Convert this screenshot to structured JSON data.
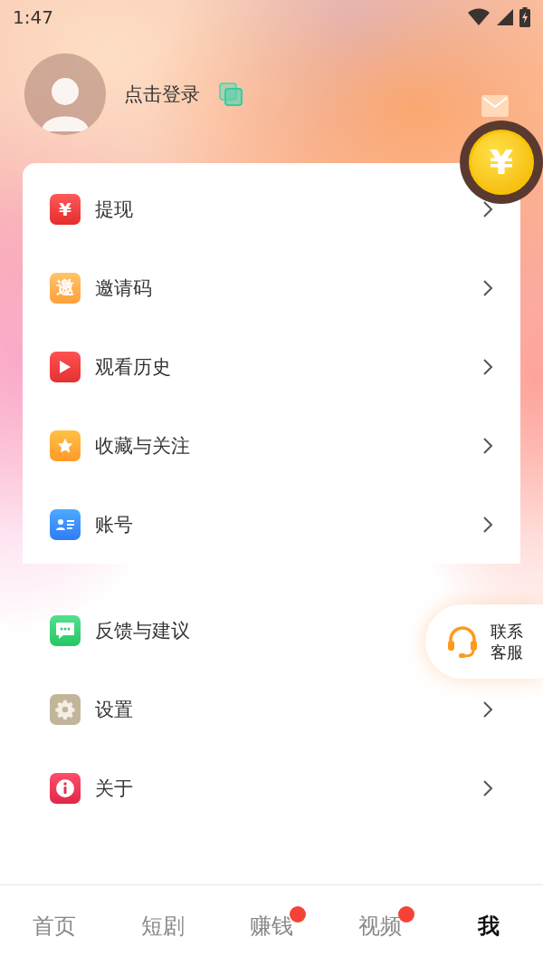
{
  "status_bar": {
    "time": "1:47"
  },
  "profile": {
    "login_label": "点击登录"
  },
  "coin": {
    "symbol": "¥"
  },
  "menu_groups": [
    {
      "items": [
        {
          "kind": "yuan",
          "glyph": "¥",
          "label": "提现"
        },
        {
          "kind": "invite",
          "glyph": "邀",
          "label": "邀请码"
        },
        {
          "kind": "play",
          "label": "观看历史"
        },
        {
          "kind": "star",
          "label": "收藏与关注"
        },
        {
          "kind": "idcard",
          "label": "账号"
        }
      ]
    },
    {
      "items": [
        {
          "kind": "chat",
          "label": "反馈与建议",
          "support": {
            "line_1": "联系",
            "line_2": "客服"
          }
        },
        {
          "kind": "gear",
          "label": "设置"
        },
        {
          "kind": "info",
          "label": "关于"
        }
      ]
    }
  ],
  "tabs": [
    {
      "label": "首页",
      "selected": false,
      "dot": false
    },
    {
      "label": "短剧",
      "selected": false,
      "dot": false
    },
    {
      "label": "赚钱",
      "selected": false,
      "dot": true
    },
    {
      "label": "视频",
      "selected": false,
      "dot": true
    },
    {
      "label": "我",
      "selected": true,
      "dot": false
    }
  ]
}
